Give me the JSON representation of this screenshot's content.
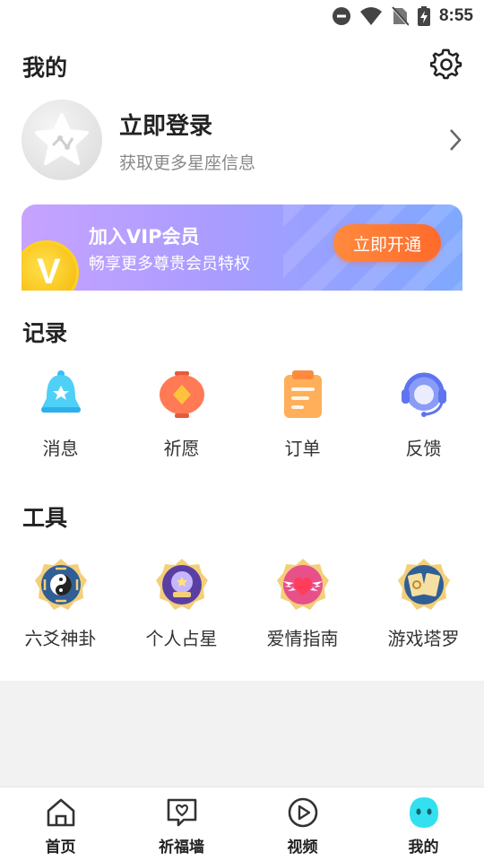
{
  "status": {
    "time": "8:55"
  },
  "header": {
    "title": "我的"
  },
  "profile": {
    "login_title": "立即登录",
    "login_subtitle": "获取更多星座信息"
  },
  "vip": {
    "title": "加入VIP会员",
    "subtitle": "畅享更多尊贵会员特权",
    "button": "立即开通",
    "coin_letter": "V"
  },
  "records": {
    "title": "记录",
    "items": [
      {
        "label": "消息",
        "icon": "bell-icon"
      },
      {
        "label": "祈愿",
        "icon": "lantern-icon"
      },
      {
        "label": "订单",
        "icon": "clipboard-icon"
      },
      {
        "label": "反馈",
        "icon": "headset-icon"
      }
    ]
  },
  "tools": {
    "title": "工具",
    "items": [
      {
        "label": "六爻神卦",
        "icon": "bagua-icon"
      },
      {
        "label": "个人占星",
        "icon": "crystal-ball-icon"
      },
      {
        "label": "爱情指南",
        "icon": "winged-heart-icon"
      },
      {
        "label": "游戏塔罗",
        "icon": "tarot-cards-icon"
      }
    ]
  },
  "tabbar": {
    "items": [
      {
        "label": "首页",
        "icon": "home-icon"
      },
      {
        "label": "祈福墙",
        "icon": "message-heart-icon"
      },
      {
        "label": "视频",
        "icon": "play-icon"
      },
      {
        "label": "我的",
        "icon": "mascot-icon"
      }
    ],
    "active_color": "#33e0f0"
  },
  "colors": {
    "vip_button": "#ff7a33",
    "vip_gradient_start": "#c7a3ff",
    "vip_gradient_end": "#7fa8ff"
  }
}
